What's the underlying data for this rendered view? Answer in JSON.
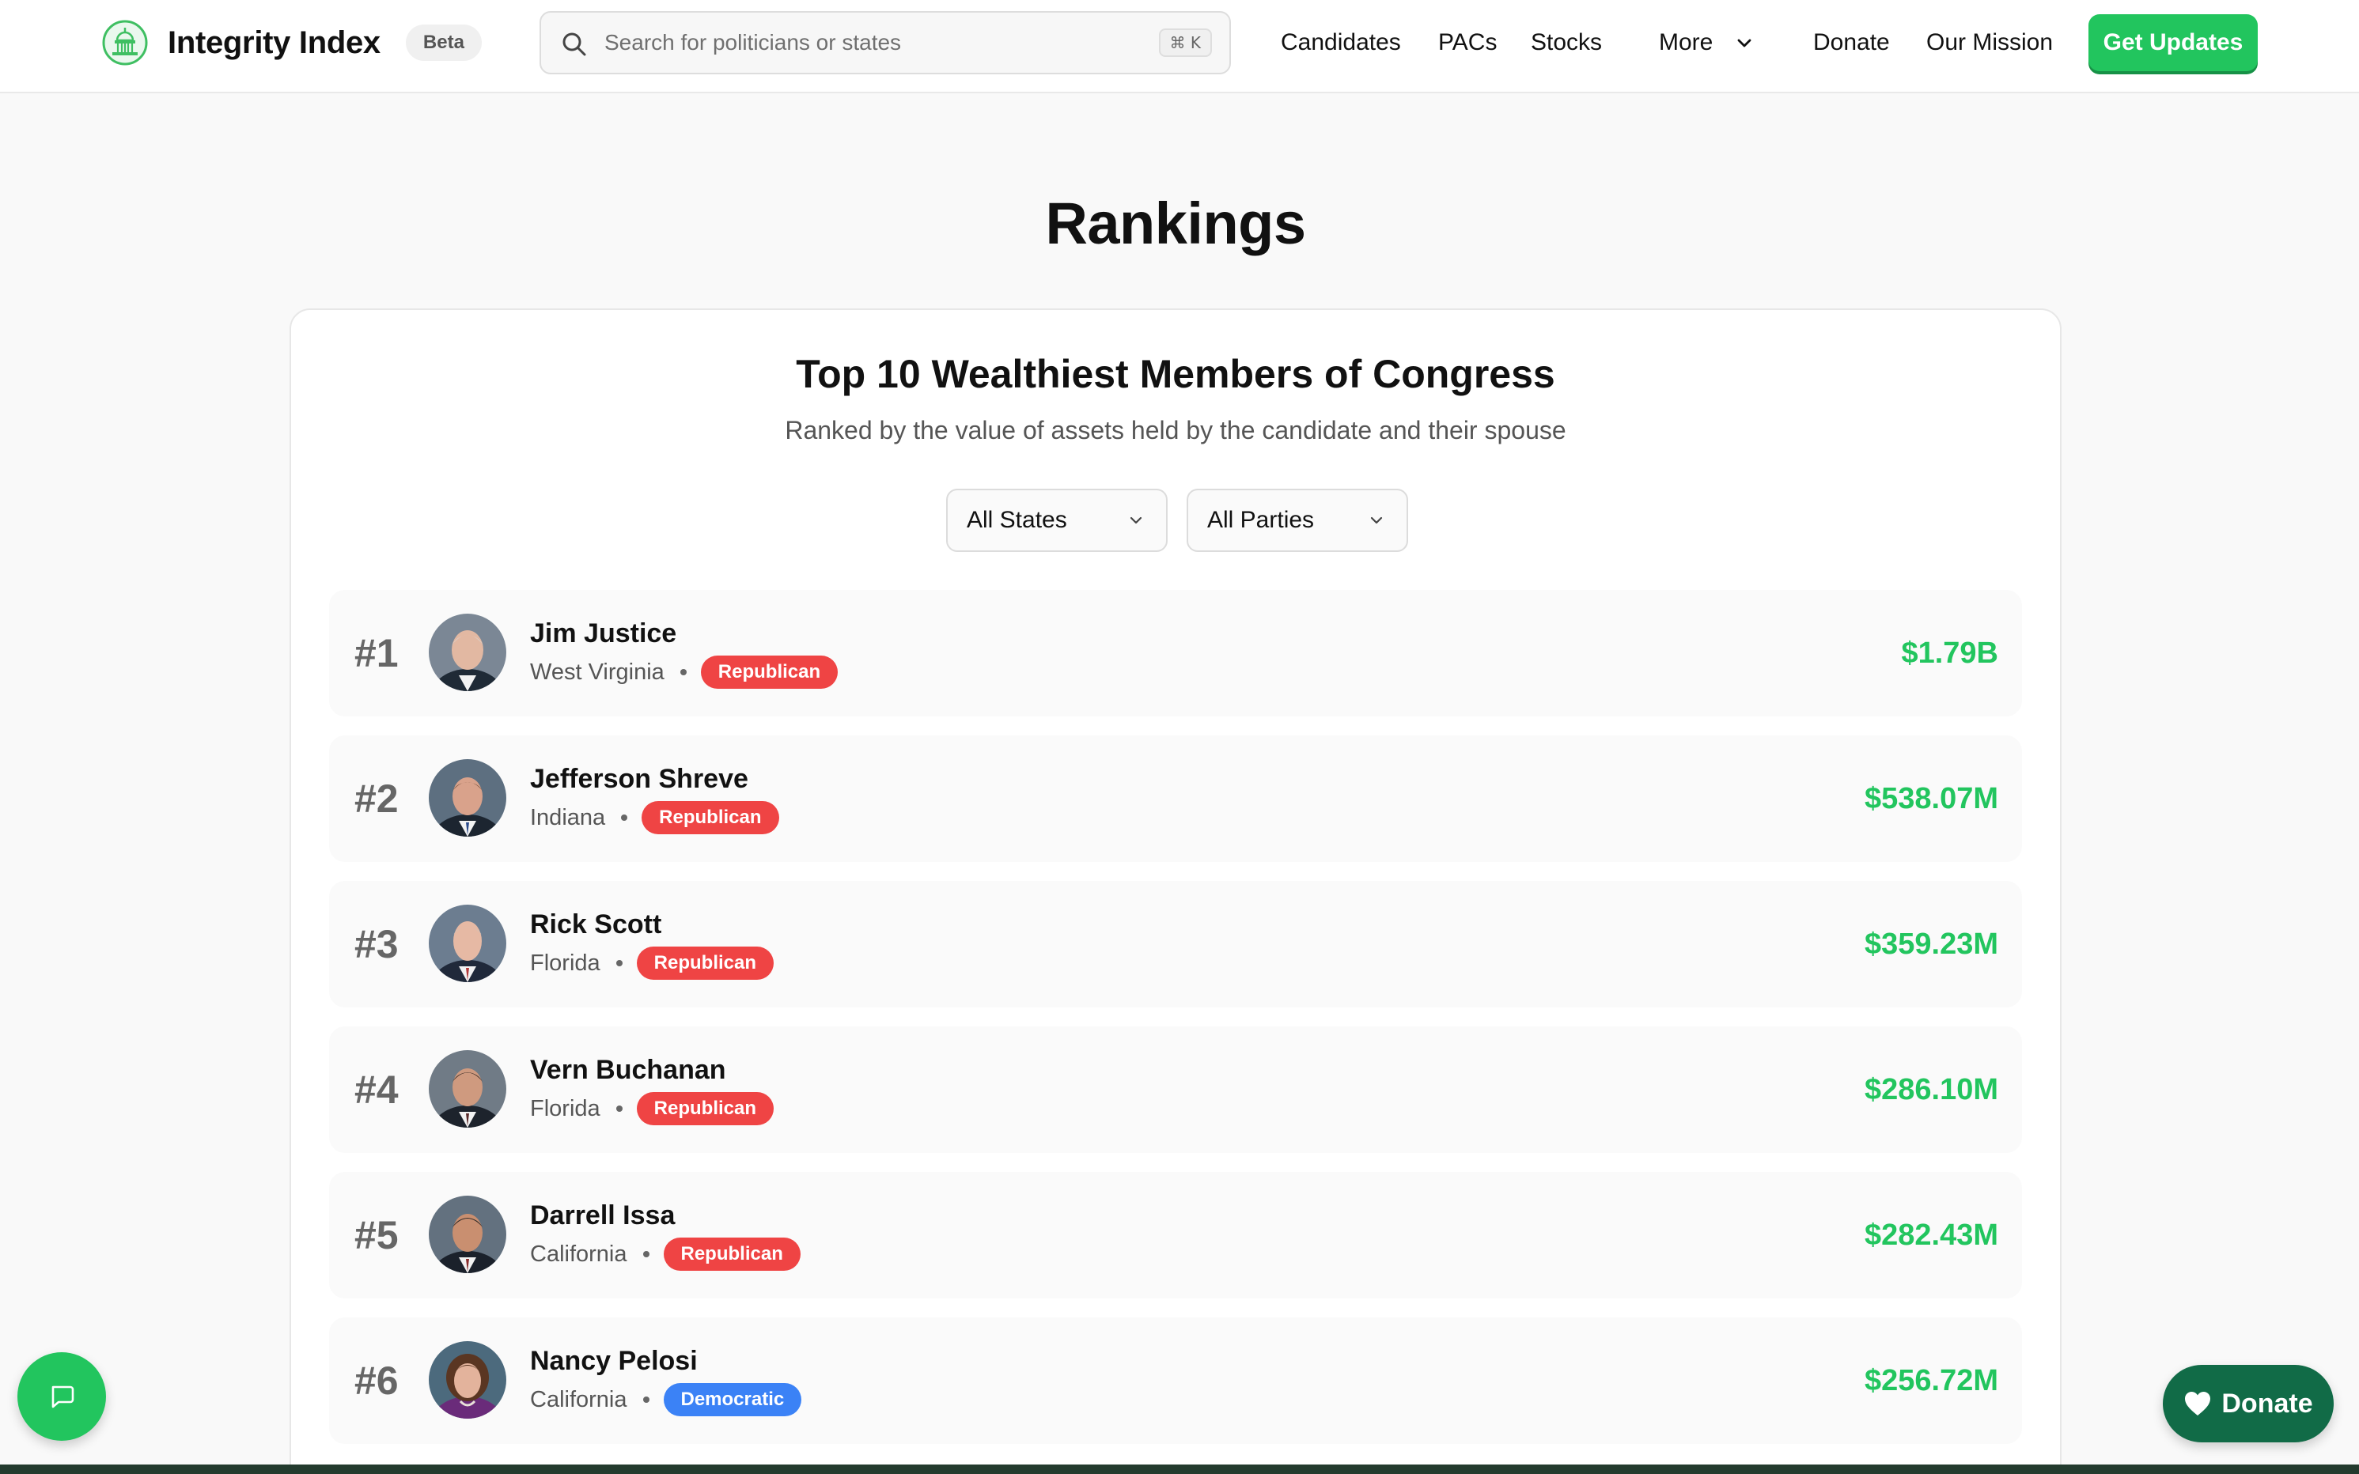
{
  "header": {
    "brand_name": "Integrity Index",
    "badge": "Beta",
    "search": {
      "placeholder": "Search for politicians or states",
      "shortcut": "⌘ K"
    },
    "nav": {
      "candidates": "Candidates",
      "pacs": "PACs",
      "stocks": "Stocks",
      "more": "More",
      "donate": "Donate",
      "mission": "Our Mission"
    },
    "cta": "Get Updates"
  },
  "page": {
    "title": "Rankings"
  },
  "rankings": {
    "title": "Top 10 Wealthiest Members of Congress",
    "subtitle": "Ranked by the value of assets held by the candidate and their spouse",
    "filters": {
      "state": "All States",
      "party": "All Parties"
    },
    "rows": [
      {
        "rank": "#1",
        "name": "Jim Justice",
        "state": "West Virginia",
        "party": "Republican",
        "party_key": "rep",
        "net_worth": "$1.79B"
      },
      {
        "rank": "#2",
        "name": "Jefferson Shreve",
        "state": "Indiana",
        "party": "Republican",
        "party_key": "rep",
        "net_worth": "$538.07M"
      },
      {
        "rank": "#3",
        "name": "Rick Scott",
        "state": "Florida",
        "party": "Republican",
        "party_key": "rep",
        "net_worth": "$359.23M"
      },
      {
        "rank": "#4",
        "name": "Vern Buchanan",
        "state": "Florida",
        "party": "Republican",
        "party_key": "rep",
        "net_worth": "$286.10M"
      },
      {
        "rank": "#5",
        "name": "Darrell Issa",
        "state": "California",
        "party": "Republican",
        "party_key": "rep",
        "net_worth": "$282.43M"
      },
      {
        "rank": "#6",
        "name": "Nancy Pelosi",
        "state": "California",
        "party": "Democratic",
        "party_key": "dem",
        "net_worth": "$256.72M"
      }
    ]
  },
  "floating": {
    "donate": "Donate",
    "chat_icon": "chat-bubble-icon",
    "heart_icon": "heart-icon"
  },
  "colors": {
    "accent": "#22c55e",
    "republican": "#ef4444",
    "democratic": "#3b82f6",
    "donate_fab": "#116b47"
  }
}
